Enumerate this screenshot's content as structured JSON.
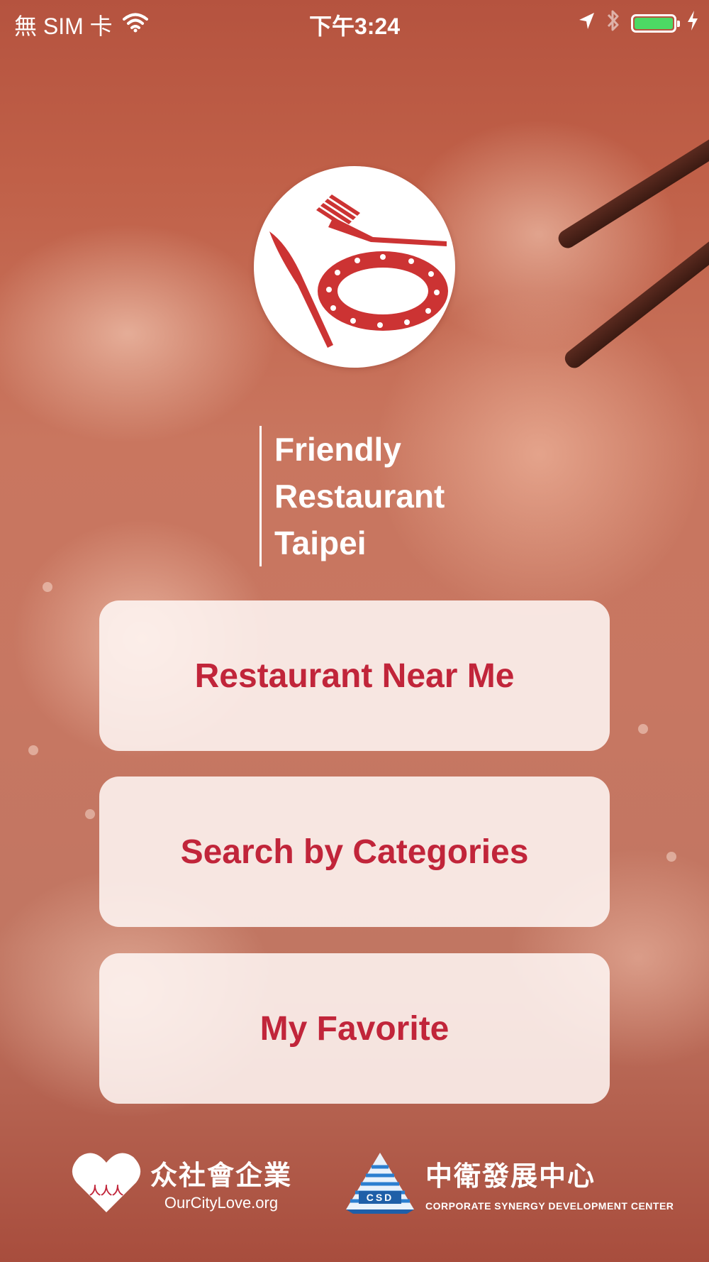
{
  "status_bar": {
    "carrier": "無 SIM 卡",
    "time": "下午3:24",
    "icons": [
      "wifi-icon",
      "location-arrow-icon",
      "bluetooth-icon",
      "battery-icon",
      "charging-bolt-icon"
    ],
    "battery_level": 1.0,
    "battery_color": "#4cd964"
  },
  "brand": {
    "line1": "Friendly",
    "line2": "Restaurant",
    "line3": "Taipei"
  },
  "menu": {
    "items": [
      {
        "label": "Restaurant Near Me"
      },
      {
        "label": "Search by Categories"
      },
      {
        "label": "My Favorite"
      }
    ]
  },
  "footer": {
    "sponsor1": {
      "name": "众社會企業",
      "sub": "OurCityLove.org",
      "logo_text": "人人人"
    },
    "sponsor2": {
      "name": "中衛發展中心",
      "sub": "CORPORATE SYNERGY DEVELOPMENT CENTER",
      "logo_text": "CSD"
    }
  },
  "colors": {
    "accent": "#c1253a",
    "logo_red": "#cc3333"
  }
}
